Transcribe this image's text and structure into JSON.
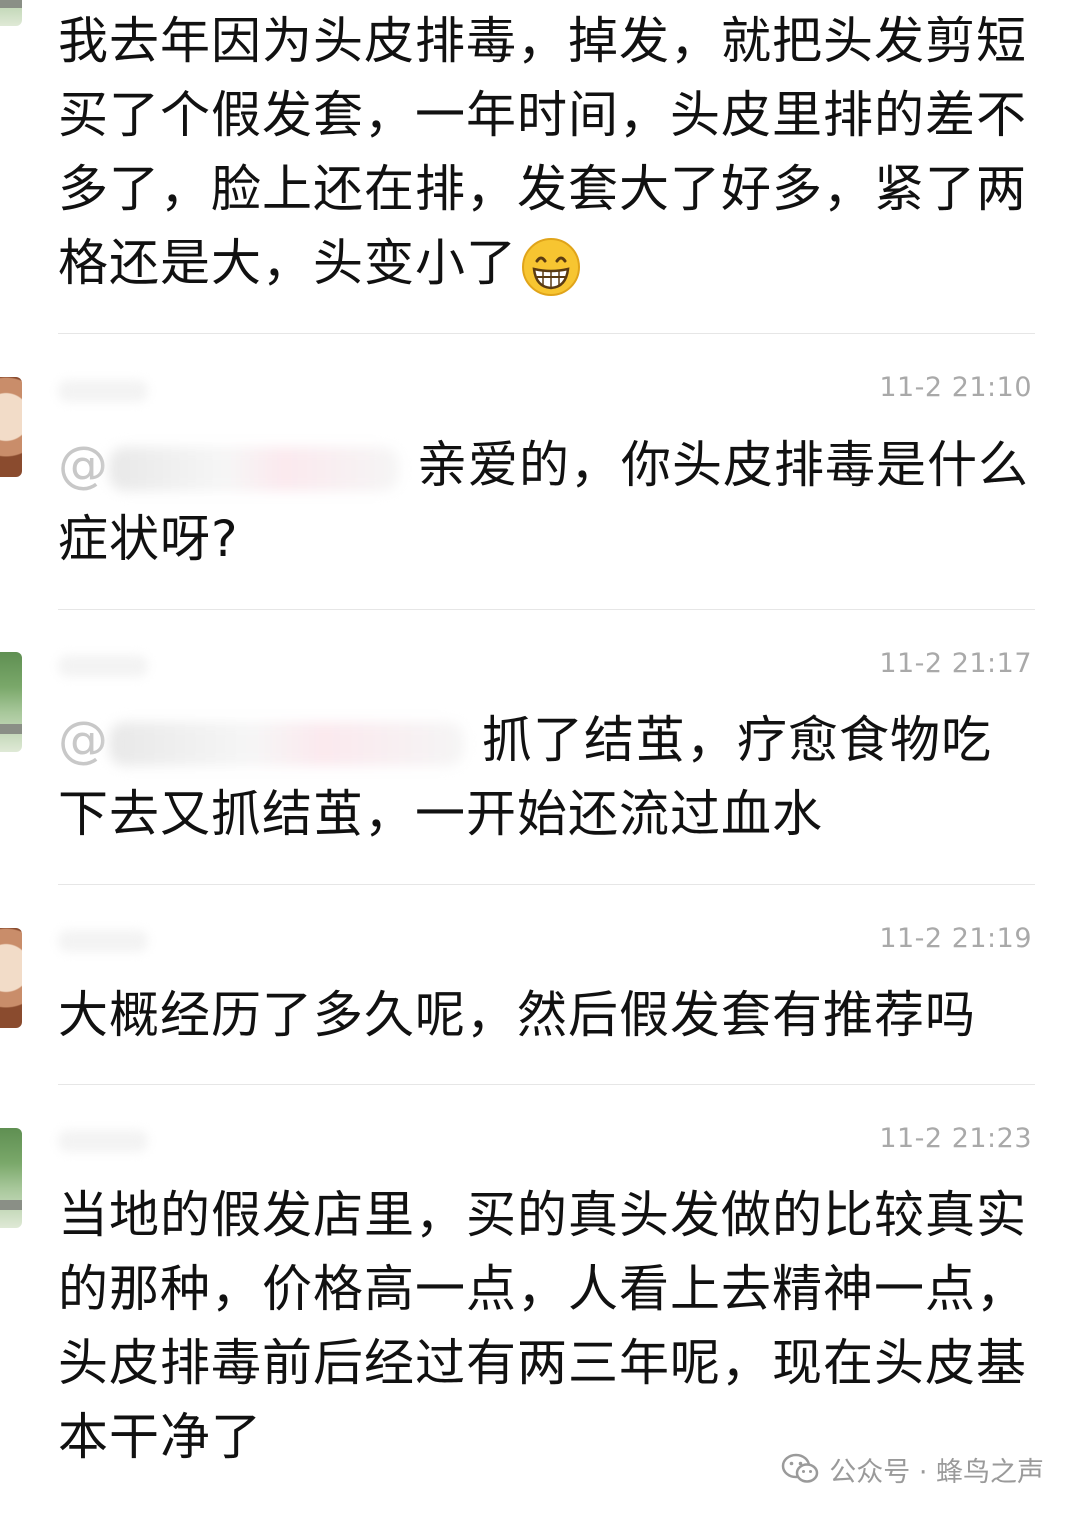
{
  "comments": [
    {
      "time": "",
      "mention_prefix": "",
      "text": "我去年因为头皮排毒，掉发，就把头发剪短买了个假发套，一年时间，头皮里排的差不多了，脸上还在排，发套大了好多，紧了两格还是大，头变小了"
    },
    {
      "time": "11-2 21:10",
      "mention_prefix": "@",
      "text": "亲爱的，你头皮排毒是什么症状呀?"
    },
    {
      "time": "11-2 21:17",
      "mention_prefix": "@",
      "text": "抓了结茧，疗愈食物吃下去又抓结茧，一开始还流过血水"
    },
    {
      "time": "11-2 21:19",
      "mention_prefix": "",
      "text": "大概经历了多久呢，然后假发套有推荐吗"
    },
    {
      "time": "11-2 21:23",
      "mention_prefix": "",
      "text": "当地的假发店里，买的真头发做的比较真实的那种，价格高一点，人看上去精神一点，头皮排毒前后经过有两三年呢，现在头皮基本干净了"
    }
  ],
  "emoji_icon": "grinning-face-icon",
  "watermark": {
    "icon": "wechat-icon",
    "text": "公众号 · 蜂鸟之声"
  }
}
